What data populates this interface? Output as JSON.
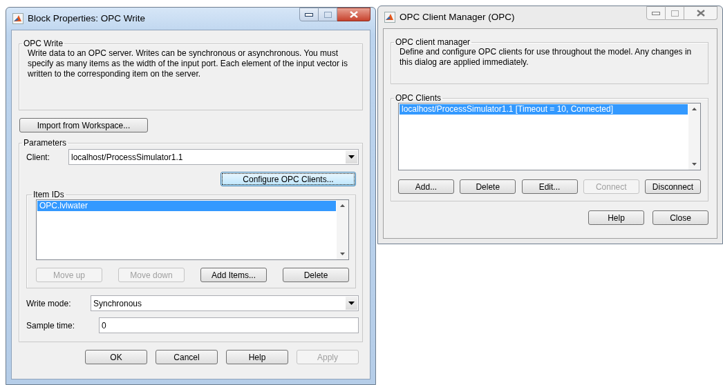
{
  "block_properties": {
    "title": "Block Properties: OPC Write",
    "active": true,
    "description": {
      "legend": "OPC Write",
      "text": "Write data to an OPC server. Writes can be synchronous or asynchronous. You must specify as many items as the width of the input port. Each element of the input vector is written to the corresponding item on the server."
    },
    "import_button": "Import from Workspace...",
    "parameters": {
      "legend": "Parameters",
      "client": {
        "label": "Client:",
        "value": "localhost/ProcessSimulator1.1"
      },
      "configure_button": {
        "label": "Configure OPC Clients...",
        "focused": true
      },
      "item_ids": {
        "legend": "Item IDs",
        "items": [
          {
            "label": "OPC.lvlwater",
            "selected": true
          }
        ],
        "buttons": [
          {
            "label": "Move up",
            "disabled": true
          },
          {
            "label": "Move down",
            "disabled": true
          },
          {
            "label": "Add Items...",
            "disabled": false
          },
          {
            "label": "Delete",
            "disabled": false
          }
        ]
      },
      "write_mode": {
        "label": "Write mode:",
        "value": "Synchronous"
      },
      "sample_time": {
        "label": "Sample time:",
        "value": "0"
      }
    },
    "buttons": [
      {
        "label": "OK",
        "disabled": false
      },
      {
        "label": "Cancel",
        "disabled": false
      },
      {
        "label": "Help",
        "disabled": false
      },
      {
        "label": "Apply",
        "disabled": true
      }
    ]
  },
  "client_manager": {
    "title": "OPC Client Manager (OPC)",
    "active": false,
    "description": {
      "legend": "OPC client manager",
      "text": "Define and configure OPC clients for use throughout the model. Any changes in this dialog are applied immediately."
    },
    "clients": {
      "legend": "OPC Clients",
      "items": [
        {
          "label": "localhost/ProcessSimulator1.1 [Timeout = 10, Connected]",
          "selected": true
        }
      ],
      "buttons": [
        {
          "label": "Add...",
          "disabled": false
        },
        {
          "label": "Delete",
          "disabled": false
        },
        {
          "label": "Edit...",
          "disabled": false
        },
        {
          "label": "Connect",
          "disabled": true
        },
        {
          "label": "Disconnect",
          "disabled": false
        }
      ]
    },
    "buttons": [
      {
        "label": "Help",
        "disabled": false
      },
      {
        "label": "Close",
        "disabled": false
      }
    ]
  }
}
